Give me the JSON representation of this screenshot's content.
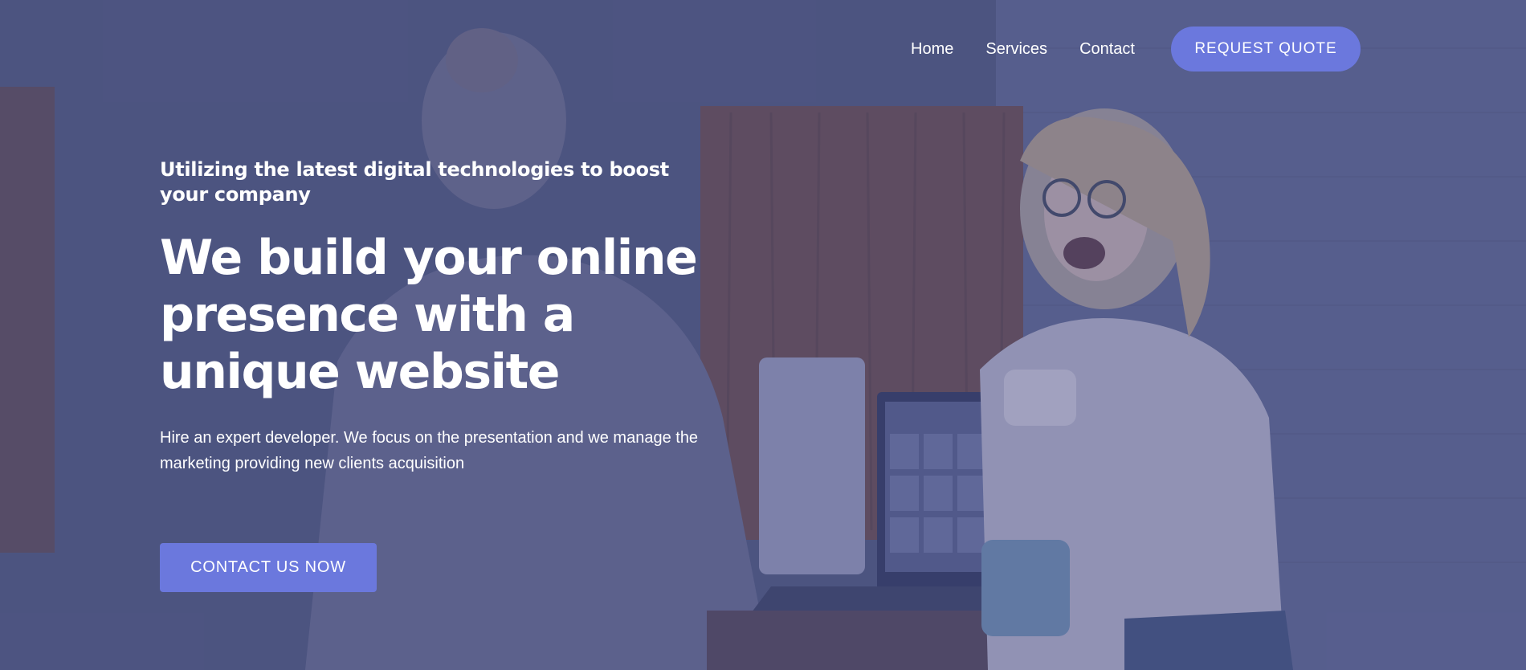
{
  "nav": {
    "items": [
      {
        "label": "Home"
      },
      {
        "label": "Services"
      },
      {
        "label": "Contact"
      }
    ],
    "cta_label": "REQUEST QUOTE"
  },
  "hero": {
    "tagline": "Utilizing the latest digital technologies to boost your company",
    "headline": "We build your online presence with a unique website",
    "description": "Hire an expert developer. We focus on the presentation and we manage the marketing providing new clients acquisition",
    "cta_label": "CONTACT US NOW"
  },
  "colors": {
    "overlay": "#4f5680",
    "accent": "#6b78dd",
    "text": "#ffffff"
  },
  "icons": {
    "background": "photo-two-people-laptop-coffee"
  }
}
